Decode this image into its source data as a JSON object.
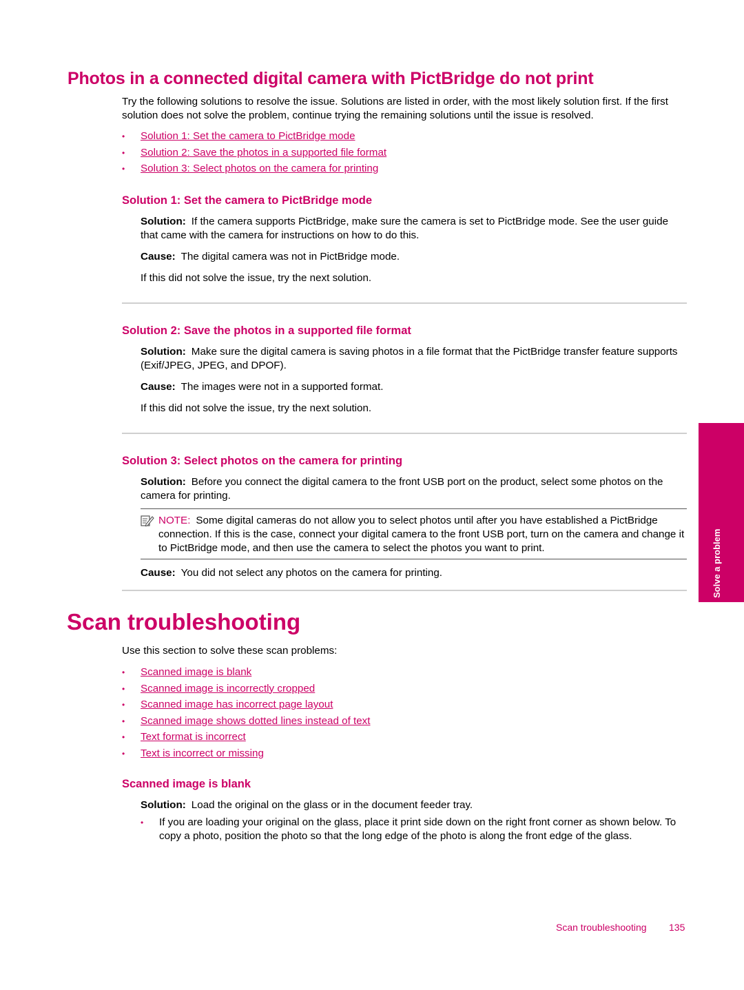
{
  "section1": {
    "title": "Photos in a connected digital camera with PictBridge do not print",
    "intro": "Try the following solutions to resolve the issue. Solutions are listed in order, with the most likely solution first. If the first solution does not solve the problem, continue trying the remaining solutions until the issue is resolved.",
    "links": [
      "Solution 1: Set the camera to PictBridge mode",
      "Solution 2: Save the photos in a supported file format",
      "Solution 3: Select photos on the camera for printing"
    ],
    "solutions": [
      {
        "heading": "Solution 1: Set the camera to PictBridge mode",
        "solution_label": "Solution:",
        "solution_text": "If the camera supports PictBridge, make sure the camera is set to PictBridge mode. See the user guide that came with the camera for instructions on how to do this.",
        "cause_label": "Cause:",
        "cause_text": "The digital camera was not in PictBridge mode.",
        "next": "If this did not solve the issue, try the next solution."
      },
      {
        "heading": "Solution 2: Save the photos in a supported file format",
        "solution_label": "Solution:",
        "solution_text": "Make sure the digital camera is saving photos in a file format that the PictBridge transfer feature supports (Exif/JPEG, JPEG, and DPOF).",
        "cause_label": "Cause:",
        "cause_text": "The images were not in a supported format.",
        "next": "If this did not solve the issue, try the next solution."
      },
      {
        "heading": "Solution 3: Select photos on the camera for printing",
        "solution_label": "Solution:",
        "solution_text": "Before you connect the digital camera to the front USB port on the product, select some photos on the camera for printing.",
        "note_label": "NOTE:",
        "note_text": "Some digital cameras do not allow you to select photos until after you have established a PictBridge connection. If this is the case, connect your digital camera to the front USB port, turn on the camera and change it to PictBridge mode, and then use the camera to select the photos you want to print.",
        "cause_label": "Cause:",
        "cause_text": "You did not select any photos on the camera for printing."
      }
    ]
  },
  "section2": {
    "title": "Scan troubleshooting",
    "intro": "Use this section to solve these scan problems:",
    "links": [
      "Scanned image is blank",
      "Scanned image is incorrectly cropped",
      "Scanned image has incorrect page layout",
      "Scanned image shows dotted lines instead of text",
      "Text format is incorrect",
      "Text is incorrect or missing"
    ],
    "blank": {
      "heading": "Scanned image is blank",
      "solution_label": "Solution:",
      "solution_text": "Load the original on the glass or in the document feeder tray.",
      "bullet": "If you are loading your original on the glass, place it print side down on the right front corner as shown below. To copy a photo, position the photo so that the long edge of the photo is along the front edge of the glass."
    }
  },
  "side_tab": {
    "label": "Solve a problem",
    "color": "#cc0066"
  },
  "footer": {
    "section": "Scan troubleshooting",
    "page": "135"
  },
  "bullet_glyph": "•"
}
